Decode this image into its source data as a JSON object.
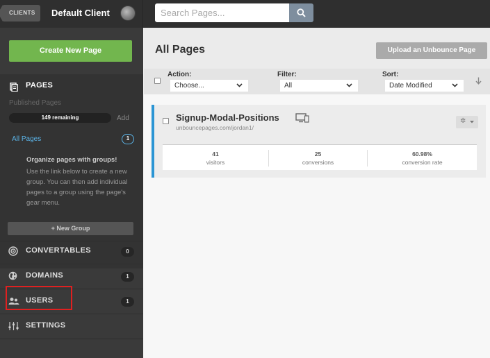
{
  "topbar": {
    "clients_label": "CLIENTS",
    "client_name": "Default Client",
    "search_placeholder": "Search Pages..."
  },
  "sidebar": {
    "create_button": "Create New Page",
    "pages": {
      "title": "PAGES",
      "published_label": "Published Pages",
      "remaining": "149 remaining",
      "add_label": "Add",
      "all_pages_label": "All Pages",
      "all_pages_count": "1",
      "organize_title": "Organize pages with groups!",
      "organize_body": "Use the link below to create a new group. You can then add individual pages to a group using the page's gear menu.",
      "new_group_button": "+ New Group"
    },
    "items": [
      {
        "label": "CONVERTABLES",
        "count": "0",
        "icon": "target-icon"
      },
      {
        "label": "DOMAINS",
        "count": "1",
        "icon": "globe-icon"
      },
      {
        "label": "USERS",
        "count": "1",
        "icon": "users-icon"
      },
      {
        "label": "SETTINGS",
        "count": "",
        "icon": "sliders-icon"
      }
    ]
  },
  "main": {
    "title": "All Pages",
    "upload_button": "Upload an Unbounce Page",
    "filters": {
      "action_label": "Action:",
      "action_value": "Choose...",
      "filter_label": "Filter:",
      "filter_value": "All",
      "sort_label": "Sort:",
      "sort_value": "Date Modified"
    },
    "page": {
      "title": "Signup-Modal-Positions",
      "url": "unbouncepages.com/jordan1/",
      "stats": [
        {
          "value": "41",
          "label": "visitors"
        },
        {
          "value": "25",
          "label": "conversions"
        },
        {
          "value": "60.98%",
          "label": "conversion rate"
        }
      ]
    }
  },
  "colors": {
    "accent_blue": "#2b95d4",
    "create_green": "#72b64e",
    "highlight_red": "#e02020"
  }
}
